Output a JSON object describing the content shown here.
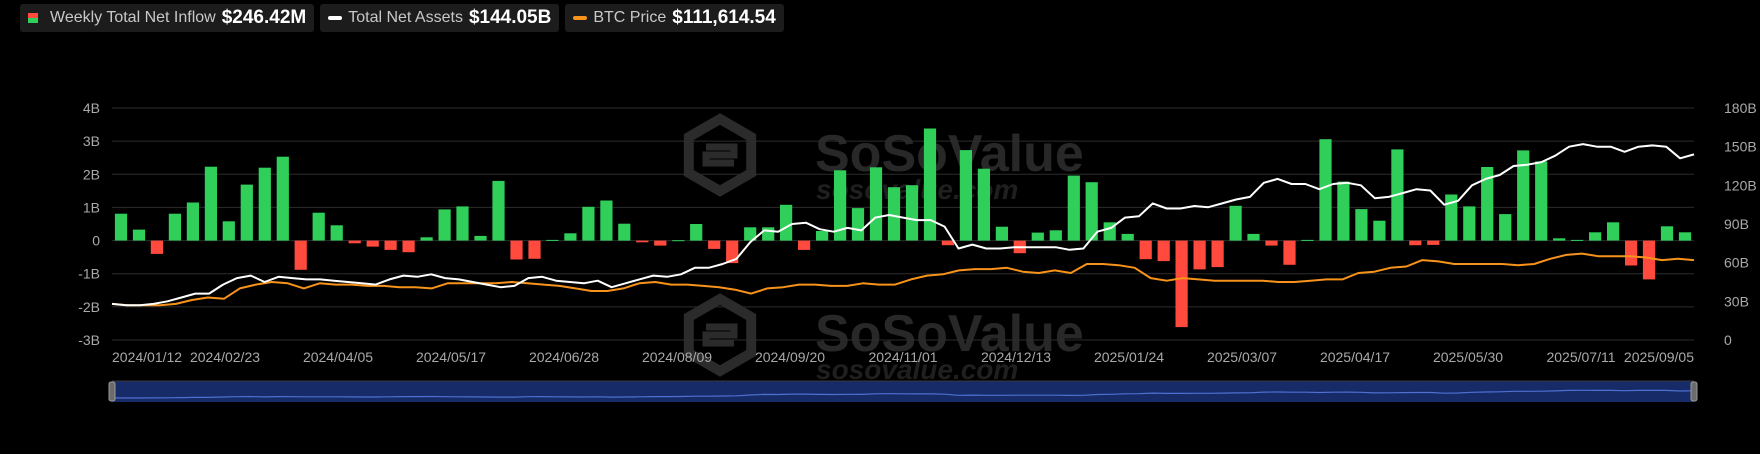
{
  "legend": {
    "inflow": {
      "label": "Weekly Total Net Inflow",
      "value": "$246.42M"
    },
    "assets": {
      "label": "Total Net Assets",
      "value": "$144.05B"
    },
    "btc": {
      "label": "BTC Price",
      "value": "$111,614.54"
    }
  },
  "watermark": {
    "name": "SoSoValue",
    "url": "sosovalue.com"
  },
  "colors": {
    "positive": "#2fcf5a",
    "negative": "#ff4a3d",
    "assets": "#ffffff",
    "btc": "#f7931a",
    "navigator": "#1e3a8a"
  },
  "chart_data": {
    "type": "bar",
    "y_left": {
      "range_billions": [
        -3,
        4
      ],
      "ticks": [
        "-3B",
        "-2B",
        "-1B",
        "0",
        "1B",
        "2B",
        "3B",
        "4B"
      ]
    },
    "y_right": {
      "range_billions": [
        0,
        180
      ],
      "ticks": [
        "0",
        "30B",
        "60B",
        "90B",
        "120B",
        "150B",
        "180B"
      ]
    },
    "x_ticks": [
      "2024/01/12",
      "2024/02/23",
      "2024/04/05",
      "2024/05/17",
      "2024/06/28",
      "2024/08/09",
      "2024/09/20",
      "2024/11/01",
      "2024/12/13",
      "2025/01/24",
      "2025/03/07",
      "2025/04/17",
      "2025/05/30",
      "2025/07/11",
      "2025/09/05"
    ],
    "grid": true,
    "series": [
      {
        "name": "Weekly Total Net Inflow",
        "type": "bar",
        "unit": "B",
        "values": [
          0.81,
          0.33,
          -0.4,
          0.81,
          1.15,
          2.23,
          0.58,
          1.69,
          2.2,
          2.53,
          -0.88,
          0.84,
          0.46,
          -0.08,
          -0.18,
          -0.28,
          -0.35,
          0.1,
          0.94,
          1.03,
          0.14,
          1.8,
          -0.57,
          -0.55,
          0.02,
          0.22,
          1.02,
          1.21,
          0.51,
          -0.05,
          -0.15,
          0.01,
          0.5,
          -0.25,
          -0.68,
          0.4,
          0.4,
          1.08,
          -0.28,
          0.29,
          2.12,
          0.98,
          2.21,
          1.61,
          1.67,
          3.38,
          -0.14,
          2.73,
          2.17,
          0.42,
          -0.38,
          0.24,
          0.31,
          1.96,
          1.76,
          0.55,
          0.2,
          -0.56,
          -0.62,
          -2.61,
          -0.87,
          -0.8,
          1.05,
          0.2,
          -0.15,
          -0.73,
          0.02,
          3.06,
          1.78,
          0.95,
          0.6,
          2.75,
          -0.14,
          -0.13,
          1.39,
          1.03,
          2.22,
          0.8,
          2.72,
          2.39,
          0.07,
          0.02,
          0.25,
          0.55,
          -0.75,
          -1.17,
          0.43,
          0.25
        ]
      },
      {
        "name": "Total Net Assets",
        "type": "line",
        "unit": "B",
        "values": [
          28,
          27,
          27,
          28,
          30,
          33,
          36,
          36,
          43,
          48,
          50,
          45,
          49,
          48,
          47,
          47,
          46,
          45,
          44,
          43,
          47,
          50,
          49,
          51,
          48,
          47,
          45,
          43,
          41,
          42,
          48,
          49,
          46,
          45,
          44,
          46,
          41,
          44,
          47,
          50,
          49,
          51,
          56,
          56,
          59,
          63,
          76,
          85,
          84,
          90,
          91,
          86,
          84,
          87,
          85,
          95,
          97,
          95,
          93,
          93,
          88,
          71,
          74,
          71,
          71,
          72,
          72,
          72,
          72,
          70,
          71,
          84,
          87,
          95,
          96,
          106,
          102,
          102,
          104,
          103,
          106,
          109,
          111,
          122,
          125,
          121,
          121,
          117,
          121,
          122,
          120,
          110,
          111,
          114,
          117,
          116,
          105,
          108,
          120,
          125,
          128,
          135,
          136,
          138,
          143,
          150,
          152,
          150,
          150,
          146,
          150,
          151,
          150,
          141,
          144
        ]
      },
      {
        "name": "BTC Price",
        "type": "line",
        "unit": "B",
        "values": [
          28,
          27,
          27,
          27,
          28,
          31,
          33,
          32,
          40,
          43,
          45,
          44,
          40,
          44,
          43,
          43,
          42,
          42,
          41,
          41,
          40,
          44,
          44,
          44,
          44,
          45,
          44,
          43,
          42,
          40,
          38,
          38,
          40,
          44,
          45,
          43,
          43,
          42,
          41,
          39,
          36,
          40,
          41,
          43,
          43,
          42,
          42,
          44,
          43,
          43,
          47,
          50,
          51,
          54,
          55,
          55,
          56,
          53,
          52,
          54,
          52,
          59,
          59,
          58,
          56,
          48,
          46,
          48,
          47,
          46,
          46,
          46,
          46,
          45,
          45,
          46,
          47,
          47,
          52,
          53,
          56,
          57,
          62,
          61,
          59,
          59,
          59,
          59,
          58,
          59,
          63,
          66,
          67,
          65,
          65,
          65,
          64,
          62,
          63,
          62
        ]
      }
    ]
  }
}
